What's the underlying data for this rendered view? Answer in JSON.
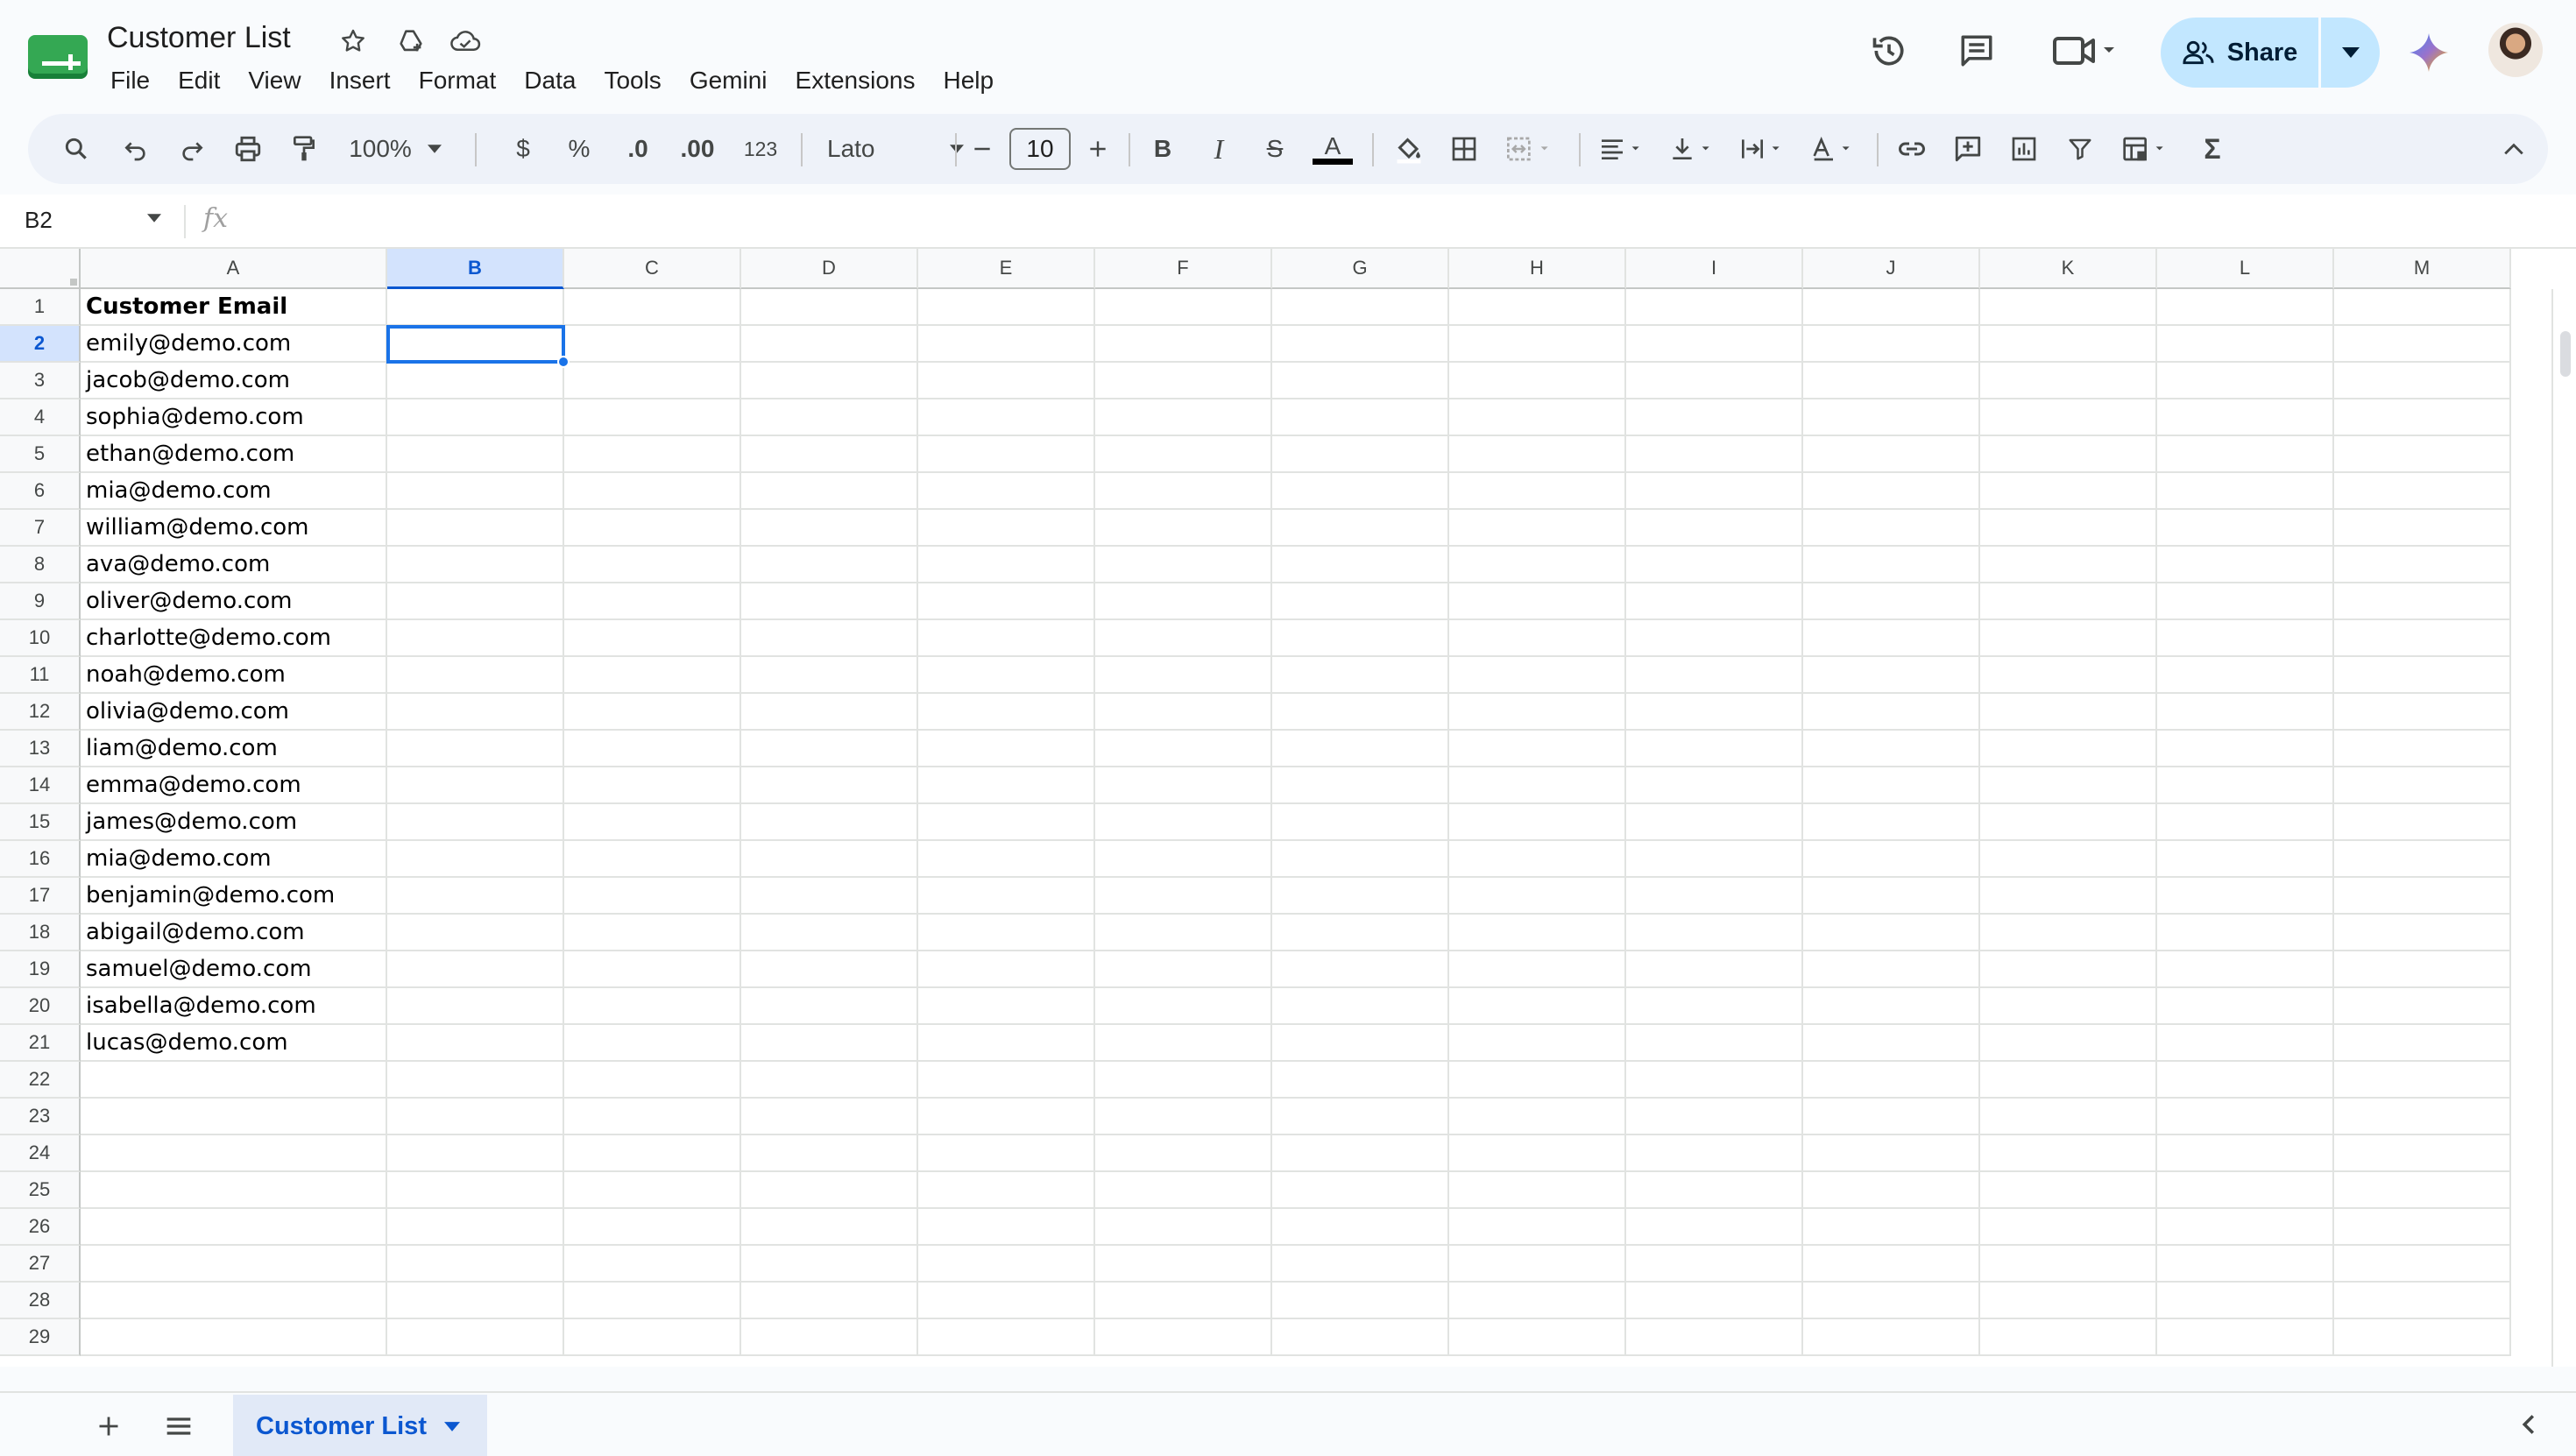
{
  "app": {
    "doc_title": "Customer List",
    "menu": [
      "File",
      "Edit",
      "View",
      "Insert",
      "Format",
      "Data",
      "Tools",
      "Gemini",
      "Extensions",
      "Help"
    ],
    "share_label": "Share",
    "accent_color": "#0b57d0",
    "share_bg": "#c2e7ff"
  },
  "title_icons": [
    "star-icon",
    "move-to-drive-icon",
    "cloud-saved-icon"
  ],
  "top_right_icons": [
    "version-history-icon",
    "comments-icon",
    "meet-video-icon",
    "gemini-icon",
    "avatar"
  ],
  "toolbar": {
    "zoom": "100%",
    "currency": "$",
    "percent": "%",
    "decrease_decimal": ".0",
    "increase_decimal": ".00",
    "number_format": "123",
    "font": "Lato",
    "font_size": "10",
    "bold": "B",
    "italic": "I",
    "strikethrough": "S",
    "text_color_letter": "A",
    "text_color": "#000000",
    "sum": "Σ"
  },
  "formula_bar": {
    "name_box": "B2",
    "fx": "fx",
    "content": ""
  },
  "grid": {
    "columns": [
      "A",
      "B",
      "C",
      "D",
      "E",
      "F",
      "G",
      "H",
      "I",
      "J",
      "K",
      "L",
      "M"
    ],
    "selected_column": "B",
    "selected_row": 2,
    "selected_cell": "B2",
    "rows": [
      "1",
      "2",
      "3",
      "4",
      "5",
      "6",
      "7",
      "8",
      "9",
      "10",
      "11",
      "12",
      "13",
      "14",
      "15",
      "16",
      "17",
      "18",
      "19",
      "20",
      "21",
      "22",
      "23",
      "24",
      "25",
      "26",
      "27",
      "28",
      "29"
    ],
    "column_a": [
      "Customer Email",
      "emily@demo.com",
      "jacob@demo.com",
      "sophia@demo.com",
      "ethan@demo.com",
      "mia@demo.com",
      "william@demo.com",
      "ava@demo.com",
      "oliver@demo.com",
      "charlotte@demo.com",
      "noah@demo.com",
      "olivia@demo.com",
      "liam@demo.com",
      "emma@demo.com",
      "james@demo.com",
      "mia@demo.com",
      "benjamin@demo.com",
      "abigail@demo.com",
      "samuel@demo.com",
      "isabella@demo.com",
      "lucas@demo.com"
    ]
  },
  "sheets": {
    "active": "Customer List"
  }
}
